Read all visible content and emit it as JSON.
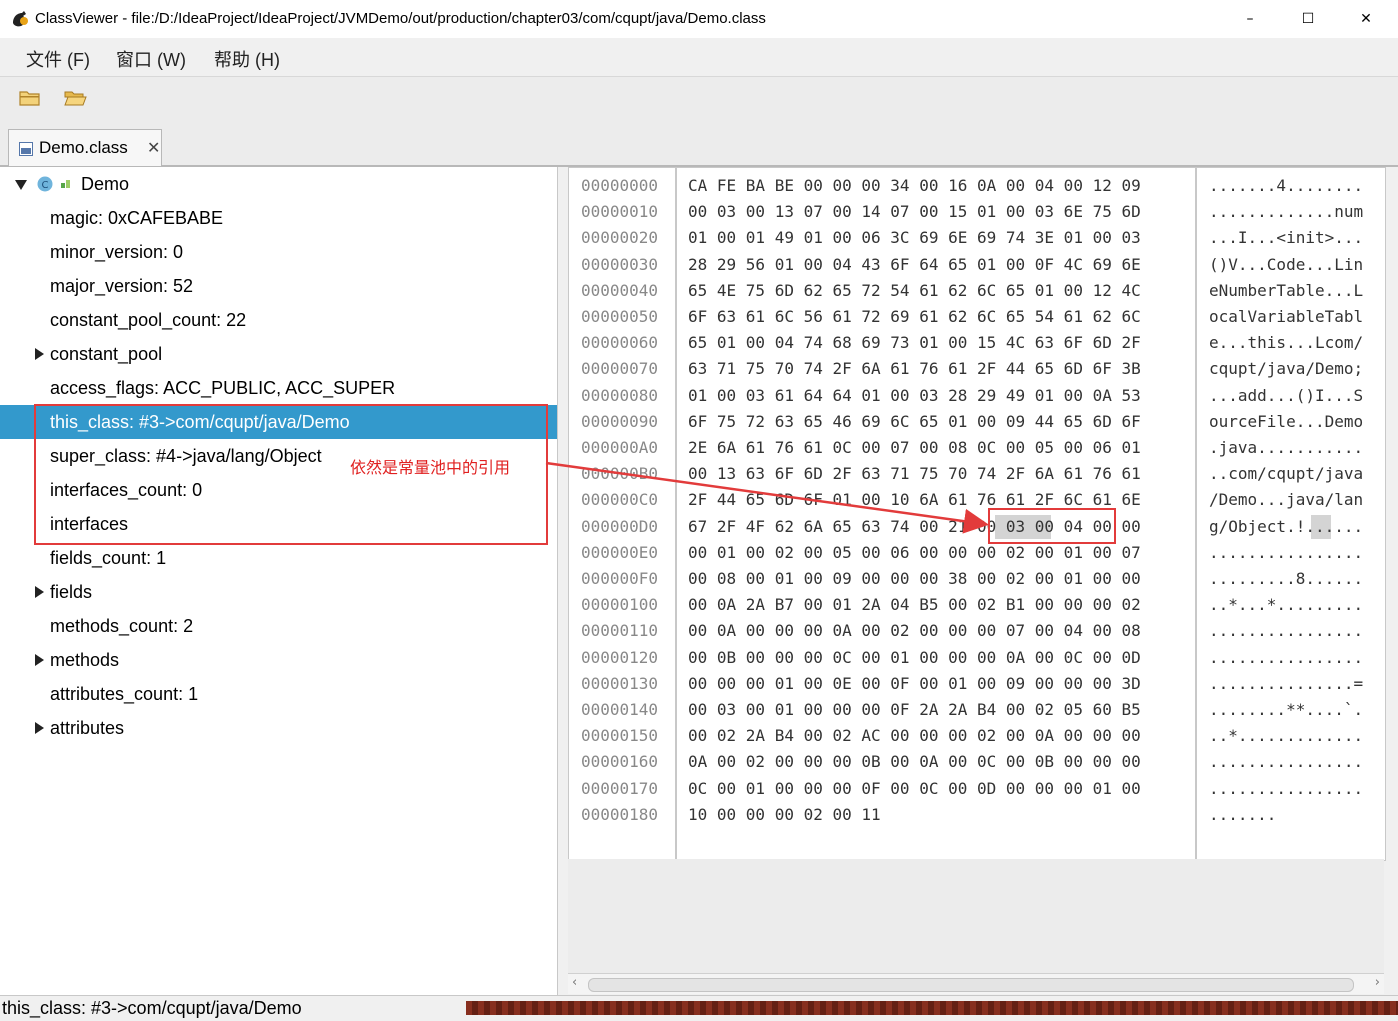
{
  "window": {
    "title": "ClassViewer - file:/D:/IdeaProject/IdeaProject/JVMDemo/out/production/chapter03/com/cqupt/java/Demo.class",
    "minimize_glyph": "–",
    "maximize_glyph": "☐",
    "close_glyph": "✕"
  },
  "menu": [
    {
      "label": "文件 (F)"
    },
    {
      "label": "窗口 (W)"
    },
    {
      "label": "帮助 (H)"
    }
  ],
  "toolbar": {
    "buttons": [
      {
        "icon": "folder-icon"
      },
      {
        "icon": "folder-open-icon"
      }
    ]
  },
  "tabs": [
    {
      "label": "Demo.class",
      "close": "✕"
    }
  ],
  "tree": {
    "root": "Demo",
    "items": [
      {
        "label": "magic: 0xCAFEBABE"
      },
      {
        "label": "minor_version: 0"
      },
      {
        "label": "major_version: 52"
      },
      {
        "label": "constant_pool_count: 22"
      },
      {
        "label": "constant_pool"
      },
      {
        "label": "access_flags: ACC_PUBLIC, ACC_SUPER"
      },
      {
        "label": "this_class: #3->com/cqupt/java/Demo"
      },
      {
        "label": "super_class: #4->java/lang/Object"
      },
      {
        "label": "interfaces_count: 0"
      },
      {
        "label": "interfaces"
      },
      {
        "label": "fields_count: 1"
      },
      {
        "label": "fields"
      },
      {
        "label": "methods_count: 2"
      },
      {
        "label": "methods"
      },
      {
        "label": "attributes_count: 1"
      },
      {
        "label": "attributes"
      }
    ]
  },
  "annotation": {
    "text": "依然是常量池中的引用",
    "color": "#e02020"
  },
  "hex": {
    "rows": [
      {
        "addr": "00000000",
        "hex": "CA FE BA BE 00 00 00 34 00 16 0A 00 04 00 12 09",
        "ascii": ".......4........"
      },
      {
        "addr": "00000010",
        "hex": "00 03 00 13 07 00 14 07 00 15 01 00 03 6E 75 6D",
        "ascii": ".............num"
      },
      {
        "addr": "00000020",
        "hex": "01 00 01 49 01 00 06 3C 69 6E 69 74 3E 01 00 03",
        "ascii": "...I...<init>..."
      },
      {
        "addr": "00000030",
        "hex": "28 29 56 01 00 04 43 6F 64 65 01 00 0F 4C 69 6E",
        "ascii": "()V...Code...Lin"
      },
      {
        "addr": "00000040",
        "hex": "65 4E 75 6D 62 65 72 54 61 62 6C 65 01 00 12 4C",
        "ascii": "eNumberTable...L"
      },
      {
        "addr": "00000050",
        "hex": "6F 63 61 6C 56 61 72 69 61 62 6C 65 54 61 62 6C",
        "ascii": "ocalVariableTabl"
      },
      {
        "addr": "00000060",
        "hex": "65 01 00 04 74 68 69 73 01 00 15 4C 63 6F 6D 2F",
        "ascii": "e...this...Lcom/"
      },
      {
        "addr": "00000070",
        "hex": "63 71 75 70 74 2F 6A 61 76 61 2F 44 65 6D 6F 3B",
        "ascii": "cqupt/java/Demo;"
      },
      {
        "addr": "00000080",
        "hex": "01 00 03 61 64 64 01 00 03 28 29 49 01 00 0A 53",
        "ascii": "...add...()I...S"
      },
      {
        "addr": "00000090",
        "hex": "6F 75 72 63 65 46 69 6C 65 01 00 09 44 65 6D 6F",
        "ascii": "ourceFile...Demo"
      },
      {
        "addr": "000000A0",
        "hex": "2E 6A 61 76 61 0C 00 07 00 08 0C 00 05 00 06 01",
        "ascii": ".java..........."
      },
      {
        "addr": "000000B0",
        "hex": "00 13 63 6F 6D 2F 63 71 75 70 74 2F 6A 61 76 61",
        "ascii": "..com/cqupt/java"
      },
      {
        "addr": "000000C0",
        "hex": "2F 44 65 6D 6F 01 00 10 6A 61 76 61 2F 6C 61 6E",
        "ascii": "/Demo...java/lan"
      },
      {
        "addr": "000000D0",
        "hex": "67 2F 4F 62 6A 65 63 74 00 21 00 03 00 04 00 00",
        "ascii": "g/Object.!......"
      },
      {
        "addr": "000000E0",
        "hex": "00 01 00 02 00 05 00 06 00 00 00 02 00 01 00 07",
        "ascii": "................"
      },
      {
        "addr": "000000F0",
        "hex": "00 08 00 01 00 09 00 00 00 38 00 02 00 01 00 00",
        "ascii": ".........8......"
      },
      {
        "addr": "00000100",
        "hex": "00 0A 2A B7 00 01 2A 04 B5 00 02 B1 00 00 00 02",
        "ascii": "..*...*........."
      },
      {
        "addr": "00000110",
        "hex": "00 0A 00 00 00 0A 00 02 00 00 00 07 00 04 00 08",
        "ascii": "................"
      },
      {
        "addr": "00000120",
        "hex": "00 0B 00 00 00 0C 00 01 00 00 00 0A 00 0C 00 0D",
        "ascii": "................"
      },
      {
        "addr": "00000130",
        "hex": "00 00 00 01 00 0E 00 0F 00 01 00 09 00 00 00 3D",
        "ascii": "...............="
      },
      {
        "addr": "00000140",
        "hex": "00 03 00 01 00 00 00 0F 2A 2A B4 00 02 05 60 B5",
        "ascii": "........**....`."
      },
      {
        "addr": "00000150",
        "hex": "00 02 2A B4 00 02 AC 00 00 00 02 00 0A 00 00 00",
        "ascii": "..*............."
      },
      {
        "addr": "00000160",
        "hex": "0A 00 02 00 00 00 0B 00 0A 00 0C 00 0B 00 00 00",
        "ascii": "................"
      },
      {
        "addr": "00000170",
        "hex": "0C 00 01 00 00 00 0F 00 0C 00 0D 00 00 00 01 00",
        "ascii": "................"
      },
      {
        "addr": "00000180",
        "hex": "10 00 00 00 02 00 11",
        "ascii": "......."
      }
    ]
  },
  "scroll": {
    "left": "‹",
    "right": "›"
  },
  "status": {
    "text": "this_class: #3->com/cqupt/java/Demo"
  }
}
